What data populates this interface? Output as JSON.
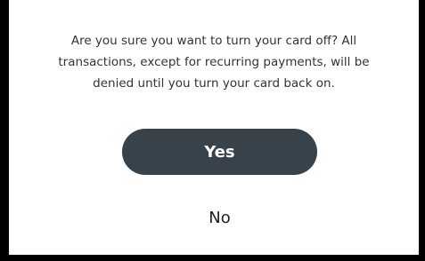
{
  "dialog": {
    "message_line1": "Are you sure you want to turn your card off? All",
    "message_line2": "transactions, except for recurring payments, will be",
    "message_line3": "denied until you turn your card back on.",
    "confirm_label": "Yes",
    "cancel_label": "No"
  },
  "colors": {
    "frame": "#000000",
    "dialog_background": "#ffffff",
    "confirm_button_background": "#37424a",
    "confirm_button_text": "#ffffff",
    "text": "#333333"
  }
}
